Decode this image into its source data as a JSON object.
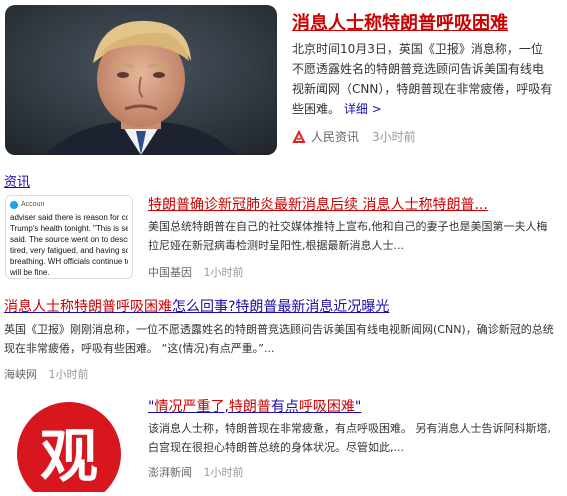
{
  "top": {
    "title": "消息人士称特朗普呼吸困难",
    "snippet": "北京时间10月3日，英国《卫报》消息称，一位不愿透露姓名的特朗普竞选顾问告诉美国有线电视新闻网（CNN），特朗普现在非常疲倦，呼吸有些困难。",
    "more": "详细 >",
    "source": "人民资讯",
    "time": "3小时前"
  },
  "section_link": "资讯",
  "item2": {
    "title": "特朗普确诊新冠肺炎最新消息后续 消息人士称特朗普...",
    "snippet": "美国总统特朗普在自己的社交媒体推特上宣布,他和自己的妻子也是美国第一夫人梅拉尼娅在新冠病毒检测时呈阳性,根据最新消息人士...",
    "source": "中国基因",
    "time": "1小时前",
    "thumb_text_lines": [
      "adviser said there is reason for conce",
      "Trump's health tonight. \"This is seriou",
      "said. The source went on to describe",
      "tired, very fatigued, and having some",
      "breathing. WH officials continue to s",
      "will be fine."
    ],
    "thumb_handle": "Accoun"
  },
  "item3": {
    "title_highlight": "消息人士称特朗普呼吸困难",
    "title_rest": "怎么回事?特朗普最新消息近况曝光",
    "snippet": "英国《卫报》刚刚消息称，一位不愿透露姓名的特朗普竞选顾问告诉美国有线电视新闻网(CNN)，确诊新冠的总统现在非常疲倦，呼吸有些困难。 “这(情况)有点严重。”...",
    "source": "海峡网",
    "time": "1小时前"
  },
  "item4": {
    "title_open": "\"",
    "title_highlight1": "情况严重了",
    "title_mid": ",",
    "title_highlight2": "特朗普",
    "title_plain": "有点",
    "title_highlight3": "呼吸困难",
    "title_close": "\"",
    "snippet": "该消息人士称，特朗普现在非常疲惫，有点呼吸困难。 另有消息人士告诉阿科斯塔,白宫现在很担心特朗普总统的身体状况。尽管如此,...",
    "source": "澎湃新闻",
    "time": "1小时前",
    "logo_text": "观"
  }
}
